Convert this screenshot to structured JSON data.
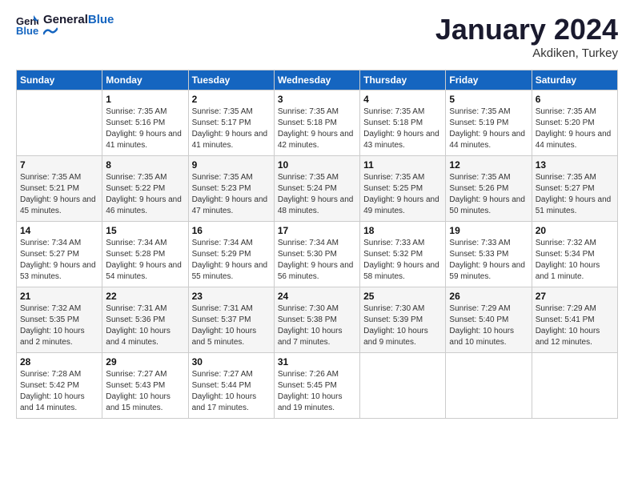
{
  "header": {
    "logo_line1": "General",
    "logo_line2": "Blue",
    "month": "January 2024",
    "location": "Akdiken, Turkey"
  },
  "weekdays": [
    "Sunday",
    "Monday",
    "Tuesday",
    "Wednesday",
    "Thursday",
    "Friday",
    "Saturday"
  ],
  "weeks": [
    [
      {
        "day": "",
        "sunrise": "",
        "sunset": "",
        "daylight": ""
      },
      {
        "day": "1",
        "sunrise": "Sunrise: 7:35 AM",
        "sunset": "Sunset: 5:16 PM",
        "daylight": "Daylight: 9 hours and 41 minutes."
      },
      {
        "day": "2",
        "sunrise": "Sunrise: 7:35 AM",
        "sunset": "Sunset: 5:17 PM",
        "daylight": "Daylight: 9 hours and 41 minutes."
      },
      {
        "day": "3",
        "sunrise": "Sunrise: 7:35 AM",
        "sunset": "Sunset: 5:18 PM",
        "daylight": "Daylight: 9 hours and 42 minutes."
      },
      {
        "day": "4",
        "sunrise": "Sunrise: 7:35 AM",
        "sunset": "Sunset: 5:18 PM",
        "daylight": "Daylight: 9 hours and 43 minutes."
      },
      {
        "day": "5",
        "sunrise": "Sunrise: 7:35 AM",
        "sunset": "Sunset: 5:19 PM",
        "daylight": "Daylight: 9 hours and 44 minutes."
      },
      {
        "day": "6",
        "sunrise": "Sunrise: 7:35 AM",
        "sunset": "Sunset: 5:20 PM",
        "daylight": "Daylight: 9 hours and 44 minutes."
      }
    ],
    [
      {
        "day": "7",
        "sunrise": "Sunrise: 7:35 AM",
        "sunset": "Sunset: 5:21 PM",
        "daylight": "Daylight: 9 hours and 45 minutes."
      },
      {
        "day": "8",
        "sunrise": "Sunrise: 7:35 AM",
        "sunset": "Sunset: 5:22 PM",
        "daylight": "Daylight: 9 hours and 46 minutes."
      },
      {
        "day": "9",
        "sunrise": "Sunrise: 7:35 AM",
        "sunset": "Sunset: 5:23 PM",
        "daylight": "Daylight: 9 hours and 47 minutes."
      },
      {
        "day": "10",
        "sunrise": "Sunrise: 7:35 AM",
        "sunset": "Sunset: 5:24 PM",
        "daylight": "Daylight: 9 hours and 48 minutes."
      },
      {
        "day": "11",
        "sunrise": "Sunrise: 7:35 AM",
        "sunset": "Sunset: 5:25 PM",
        "daylight": "Daylight: 9 hours and 49 minutes."
      },
      {
        "day": "12",
        "sunrise": "Sunrise: 7:35 AM",
        "sunset": "Sunset: 5:26 PM",
        "daylight": "Daylight: 9 hours and 50 minutes."
      },
      {
        "day": "13",
        "sunrise": "Sunrise: 7:35 AM",
        "sunset": "Sunset: 5:27 PM",
        "daylight": "Daylight: 9 hours and 51 minutes."
      }
    ],
    [
      {
        "day": "14",
        "sunrise": "Sunrise: 7:34 AM",
        "sunset": "Sunset: 5:27 PM",
        "daylight": "Daylight: 9 hours and 53 minutes."
      },
      {
        "day": "15",
        "sunrise": "Sunrise: 7:34 AM",
        "sunset": "Sunset: 5:28 PM",
        "daylight": "Daylight: 9 hours and 54 minutes."
      },
      {
        "day": "16",
        "sunrise": "Sunrise: 7:34 AM",
        "sunset": "Sunset: 5:29 PM",
        "daylight": "Daylight: 9 hours and 55 minutes."
      },
      {
        "day": "17",
        "sunrise": "Sunrise: 7:34 AM",
        "sunset": "Sunset: 5:30 PM",
        "daylight": "Daylight: 9 hours and 56 minutes."
      },
      {
        "day": "18",
        "sunrise": "Sunrise: 7:33 AM",
        "sunset": "Sunset: 5:32 PM",
        "daylight": "Daylight: 9 hours and 58 minutes."
      },
      {
        "day": "19",
        "sunrise": "Sunrise: 7:33 AM",
        "sunset": "Sunset: 5:33 PM",
        "daylight": "Daylight: 9 hours and 59 minutes."
      },
      {
        "day": "20",
        "sunrise": "Sunrise: 7:32 AM",
        "sunset": "Sunset: 5:34 PM",
        "daylight": "Daylight: 10 hours and 1 minute."
      }
    ],
    [
      {
        "day": "21",
        "sunrise": "Sunrise: 7:32 AM",
        "sunset": "Sunset: 5:35 PM",
        "daylight": "Daylight: 10 hours and 2 minutes."
      },
      {
        "day": "22",
        "sunrise": "Sunrise: 7:31 AM",
        "sunset": "Sunset: 5:36 PM",
        "daylight": "Daylight: 10 hours and 4 minutes."
      },
      {
        "day": "23",
        "sunrise": "Sunrise: 7:31 AM",
        "sunset": "Sunset: 5:37 PM",
        "daylight": "Daylight: 10 hours and 5 minutes."
      },
      {
        "day": "24",
        "sunrise": "Sunrise: 7:30 AM",
        "sunset": "Sunset: 5:38 PM",
        "daylight": "Daylight: 10 hours and 7 minutes."
      },
      {
        "day": "25",
        "sunrise": "Sunrise: 7:30 AM",
        "sunset": "Sunset: 5:39 PM",
        "daylight": "Daylight: 10 hours and 9 minutes."
      },
      {
        "day": "26",
        "sunrise": "Sunrise: 7:29 AM",
        "sunset": "Sunset: 5:40 PM",
        "daylight": "Daylight: 10 hours and 10 minutes."
      },
      {
        "day": "27",
        "sunrise": "Sunrise: 7:29 AM",
        "sunset": "Sunset: 5:41 PM",
        "daylight": "Daylight: 10 hours and 12 minutes."
      }
    ],
    [
      {
        "day": "28",
        "sunrise": "Sunrise: 7:28 AM",
        "sunset": "Sunset: 5:42 PM",
        "daylight": "Daylight: 10 hours and 14 minutes."
      },
      {
        "day": "29",
        "sunrise": "Sunrise: 7:27 AM",
        "sunset": "Sunset: 5:43 PM",
        "daylight": "Daylight: 10 hours and 15 minutes."
      },
      {
        "day": "30",
        "sunrise": "Sunrise: 7:27 AM",
        "sunset": "Sunset: 5:44 PM",
        "daylight": "Daylight: 10 hours and 17 minutes."
      },
      {
        "day": "31",
        "sunrise": "Sunrise: 7:26 AM",
        "sunset": "Sunset: 5:45 PM",
        "daylight": "Daylight: 10 hours and 19 minutes."
      },
      {
        "day": "",
        "sunrise": "",
        "sunset": "",
        "daylight": ""
      },
      {
        "day": "",
        "sunrise": "",
        "sunset": "",
        "daylight": ""
      },
      {
        "day": "",
        "sunrise": "",
        "sunset": "",
        "daylight": ""
      }
    ]
  ]
}
